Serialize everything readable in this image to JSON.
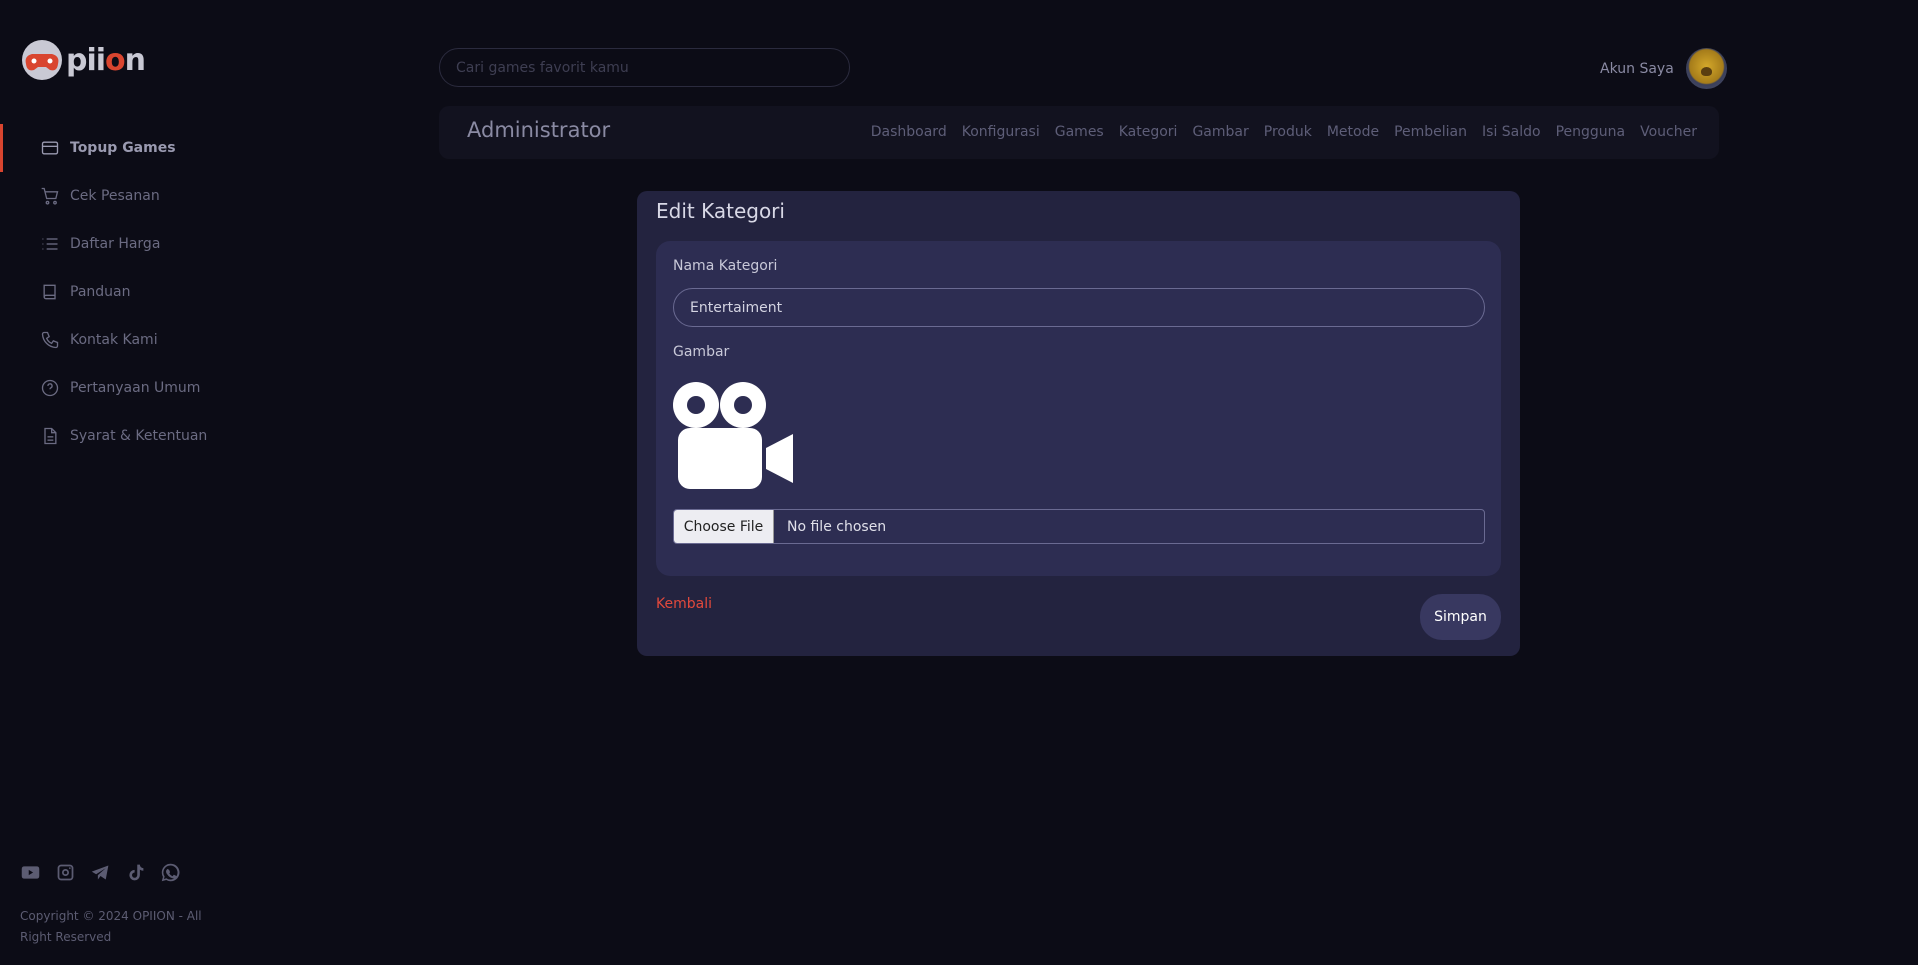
{
  "brand": {
    "logo_text_prefix": "pii",
    "logo_text_accent": "o",
    "logo_text_suffix": "n",
    "accent_color": "#d9452f"
  },
  "sidebar": {
    "items": [
      {
        "label": "Topup Games",
        "icon": "credit-card-icon",
        "active": true
      },
      {
        "label": "Cek Pesanan",
        "icon": "cart-icon",
        "active": false
      },
      {
        "label": "Daftar Harga",
        "icon": "list-icon",
        "active": false
      },
      {
        "label": "Panduan",
        "icon": "book-icon",
        "active": false
      },
      {
        "label": "Kontak Kami",
        "icon": "phone-icon",
        "active": false
      },
      {
        "label": "Pertanyaan Umum",
        "icon": "question-icon",
        "active": false
      },
      {
        "label": "Syarat & Ketentuan",
        "icon": "document-icon",
        "active": false
      }
    ],
    "socials": [
      "youtube-icon",
      "instagram-icon",
      "telegram-icon",
      "tiktok-icon",
      "whatsapp-icon"
    ],
    "copyright": "Copyright © 2024 OPIION - All Right Reserved"
  },
  "header": {
    "search_placeholder": "Cari games favorit kamu",
    "account_label": "Akun Saya"
  },
  "admin": {
    "title": "Administrator",
    "nav": [
      "Dashboard",
      "Konfigurasi",
      "Games",
      "Kategori",
      "Gambar",
      "Produk",
      "Metode",
      "Pembelian",
      "Isi Saldo",
      "Pengguna",
      "Voucher"
    ]
  },
  "form": {
    "title": "Edit Kategori",
    "name_label": "Nama Kategori",
    "name_value": "Entertaiment",
    "image_label": "Gambar",
    "image_icon": "video-camera-icon",
    "file_button": "Choose File",
    "file_status": "No file chosen",
    "back_label": "Kembali",
    "save_label": "Simpan"
  }
}
